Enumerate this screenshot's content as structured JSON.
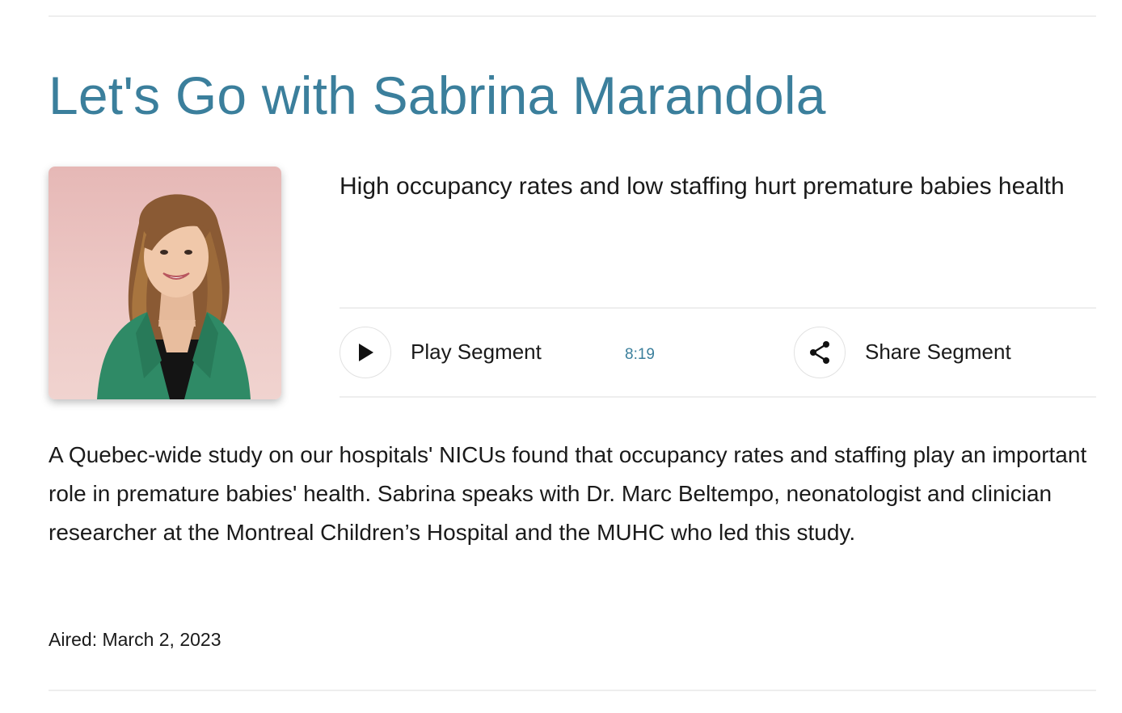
{
  "show": {
    "title": "Let's Go with Sabrina Marandola"
  },
  "host": {
    "photo_alt": "Sabrina Marandola"
  },
  "segment": {
    "title": "High occupancy rates and low staffing hurt premature babies health",
    "play_label": "Play Segment",
    "duration": "8:19",
    "share_label": "Share Segment",
    "description": "A Quebec-wide study on our hospitals' NICUs found that occupancy rates and staffing play an important role in premature babies' health. Sabrina speaks with Dr. Marc Beltempo, neonatologist and clinician researcher at the Montreal Children’s Hospital and the MUHC who led this study.",
    "aired": "Aired: March 2, 2023"
  },
  "icons": {
    "play": "play-icon",
    "share": "share-icon"
  },
  "colors": {
    "accent": "#3b7f9c",
    "text": "#1a1a1a",
    "divider": "#eeeeee"
  }
}
